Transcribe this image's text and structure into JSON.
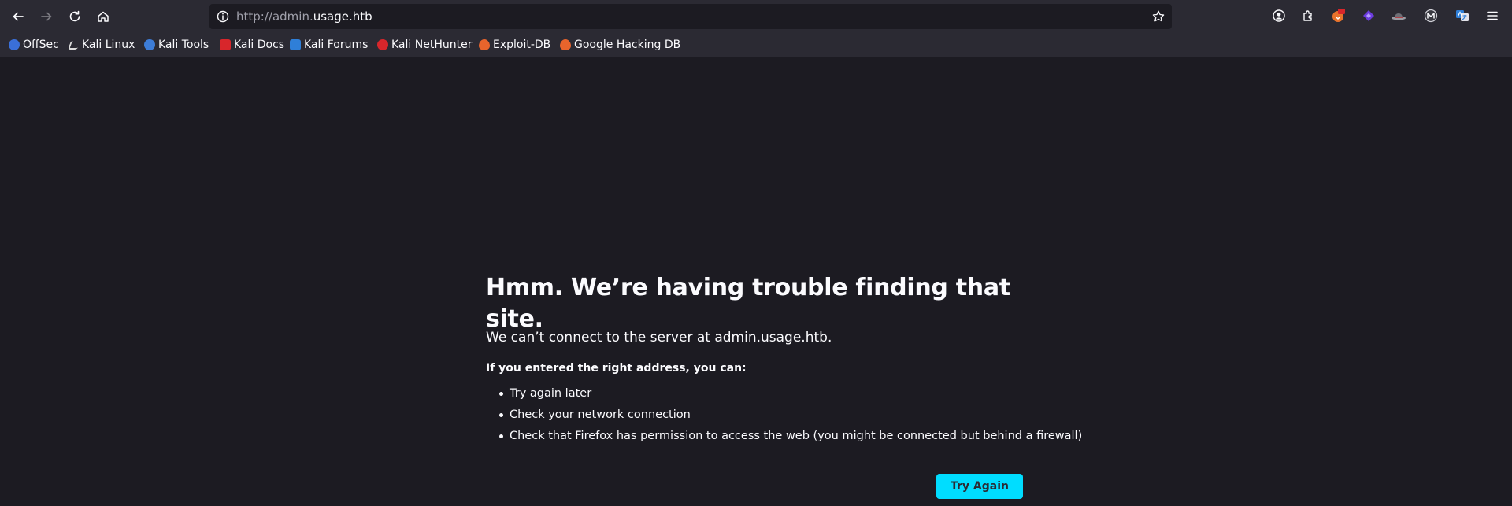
{
  "browser": {
    "url_prefix": "http://admin.",
    "url_domain": "usage.htb"
  },
  "bookmarks": [
    {
      "label": "OffSec",
      "icon": "offsec-icon",
      "color": "#3a6fd8"
    },
    {
      "label": "Kali Linux",
      "icon": "kali-dragon-icon",
      "color": "#dcdcdc"
    },
    {
      "label": "Kali Tools",
      "icon": "kali-tools-icon",
      "color": "#3d7dd8"
    },
    {
      "label": "Kali Docs",
      "icon": "kali-docs-icon",
      "color": "#d8262b"
    },
    {
      "label": "Kali Forums",
      "icon": "kali-forums-icon",
      "color": "#2f7fd8"
    },
    {
      "label": "Kali NetHunter",
      "icon": "kali-nethunter-icon",
      "color": "#d8262b"
    },
    {
      "label": "Exploit-DB",
      "icon": "exploit-db-icon",
      "color": "#e8642c"
    },
    {
      "label": "Google Hacking DB",
      "icon": "ghdb-icon",
      "color": "#e8642c"
    }
  ],
  "error": {
    "title": "Hmm. We’re having trouble finding that site.",
    "description": "We can’t connect to the server at admin.usage.htb.",
    "subheading": "If you entered the right address, you can:",
    "suggestions": [
      "Try again later",
      "Check your network connection",
      "Check that Firefox has permission to access the web (you might be connected but behind a firewall)"
    ],
    "button_label": "Try Again"
  },
  "colors": {
    "page_bg": "#1c1b22",
    "toolbar_bg": "#2b2a33",
    "accent": "#00ddff"
  }
}
